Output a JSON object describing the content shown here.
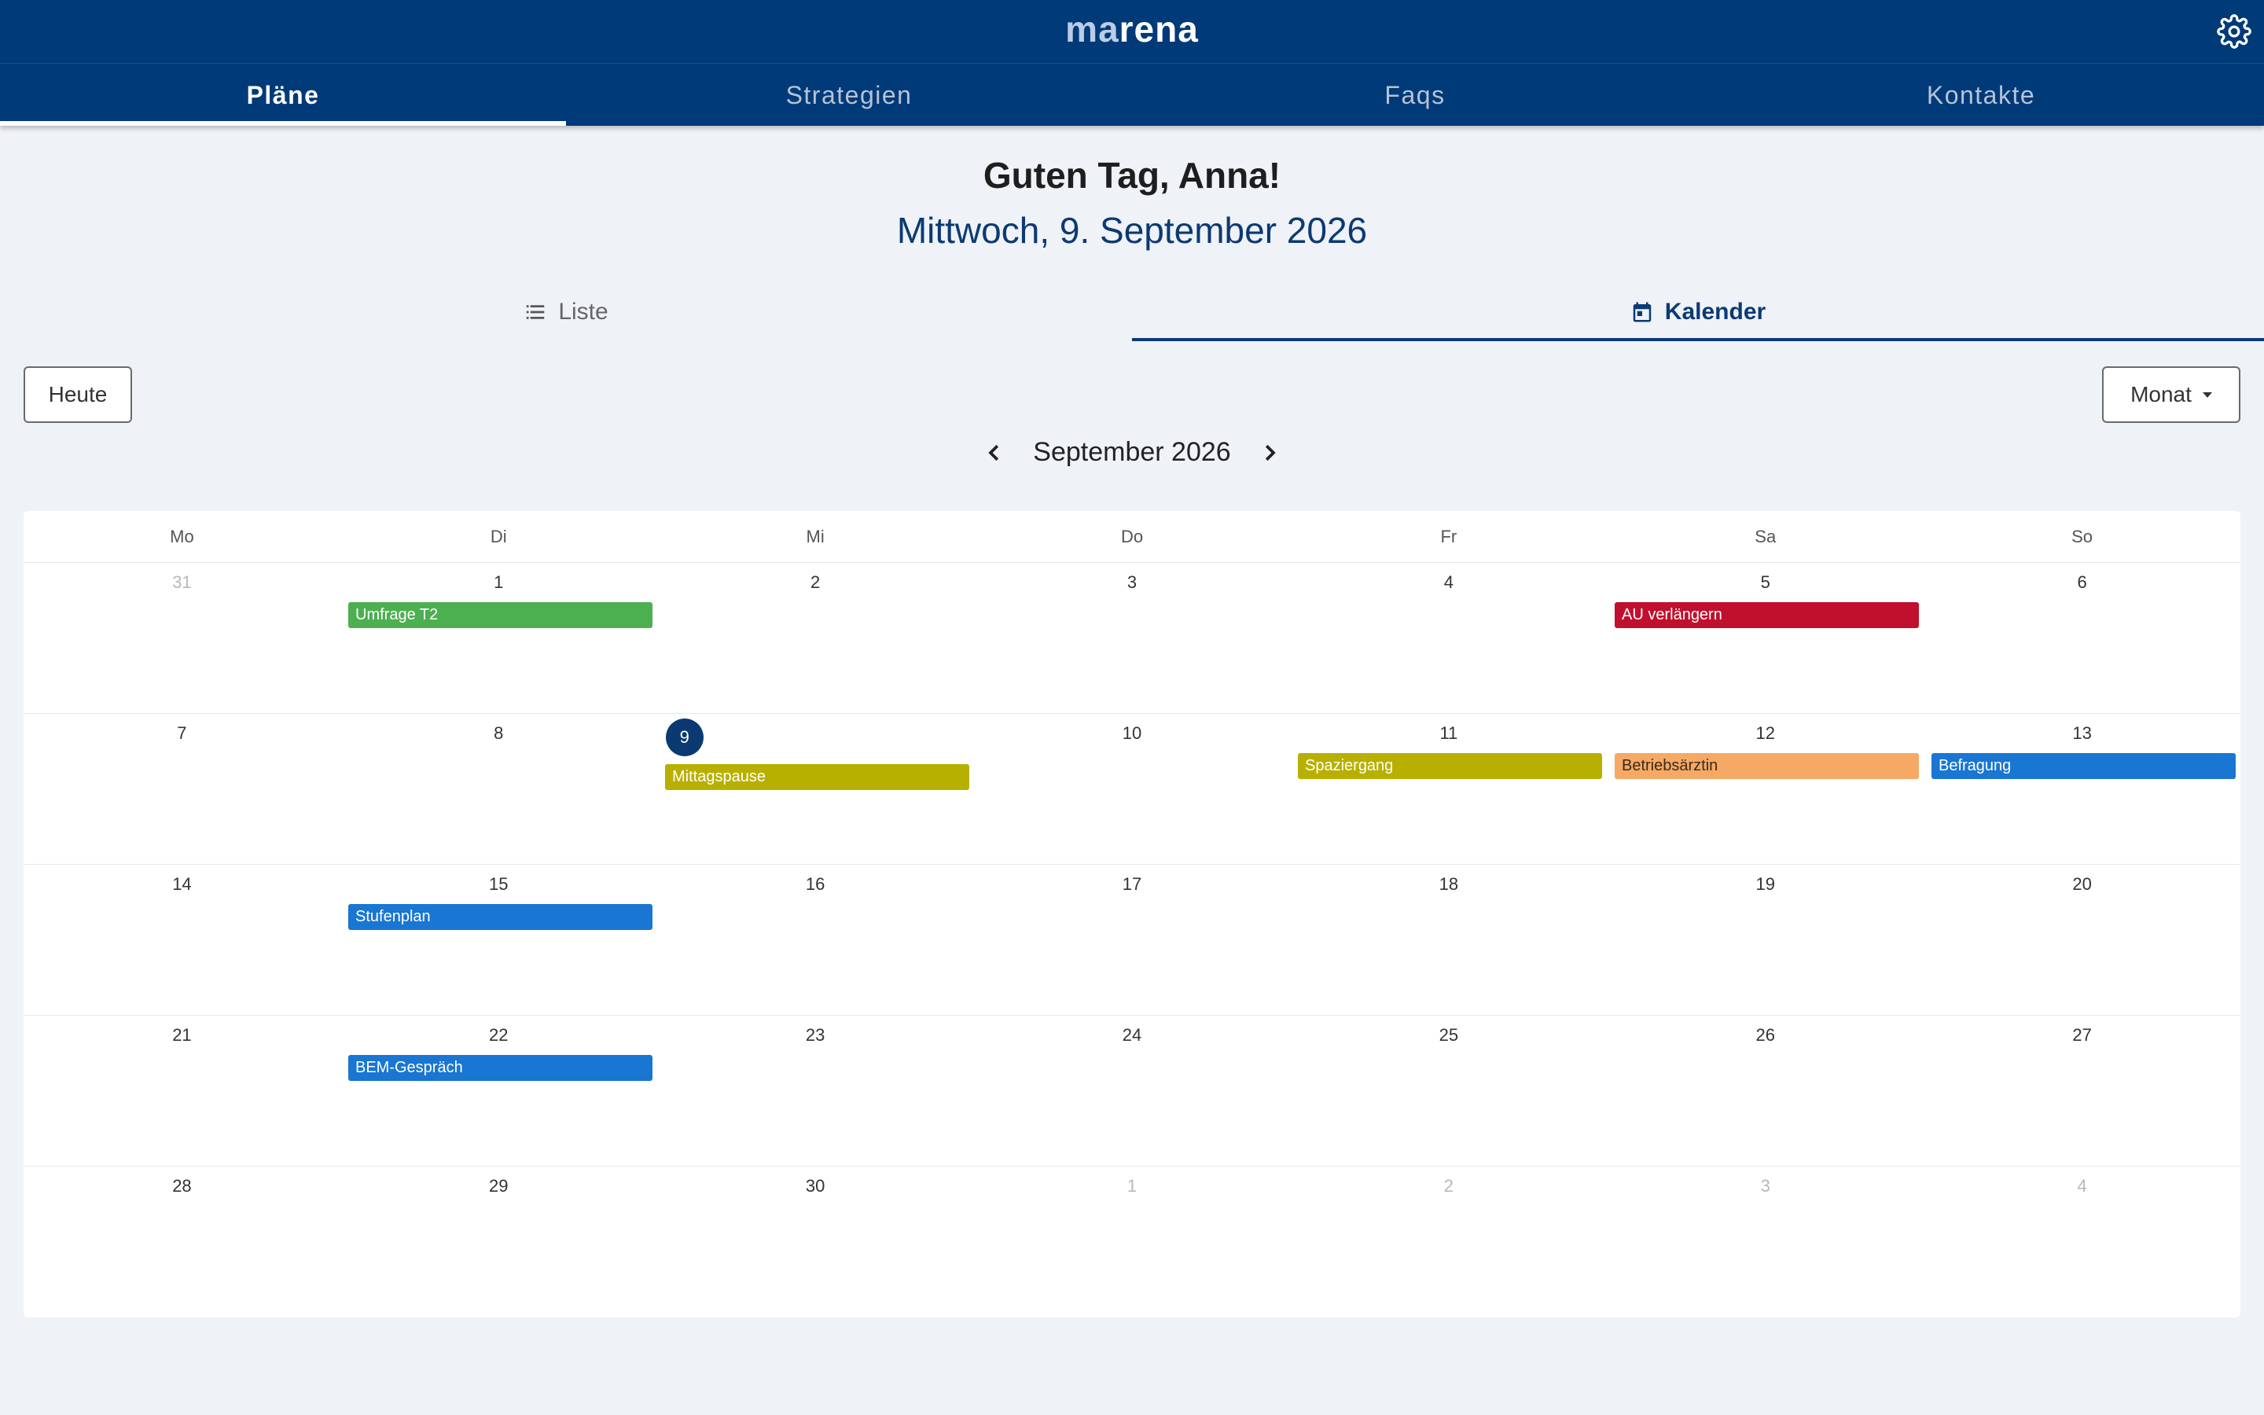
{
  "app": {
    "logo_prefix": "ma",
    "logo_suffix": "rena"
  },
  "nav": {
    "tabs": [
      "Pläne",
      "Strategien",
      "Faqs",
      "Kontakte"
    ]
  },
  "greeting": "Guten Tag, Anna!",
  "date": "Mittwoch, 9. September 2026",
  "view_tabs": {
    "list": "Liste",
    "calendar": "Kalender"
  },
  "controls": {
    "today": "Heute",
    "view_select": "Monat",
    "month_label": "September 2026"
  },
  "calendar": {
    "weekdays": [
      "Mo",
      "Di",
      "Mi",
      "Do",
      "Fr",
      "Sa",
      "So"
    ],
    "today": "9",
    "weeks": [
      [
        "31",
        "1",
        "2",
        "3",
        "4",
        "5",
        "6"
      ],
      [
        "7",
        "8",
        "9",
        "10",
        "11",
        "12",
        "13"
      ],
      [
        "14",
        "15",
        "16",
        "17",
        "18",
        "19",
        "20"
      ],
      [
        "21",
        "22",
        "23",
        "24",
        "25",
        "26",
        "27"
      ],
      [
        "28",
        "29",
        "30",
        "1",
        "2",
        "3",
        "4"
      ]
    ],
    "events": [
      {
        "label": "Umfrage T2",
        "week": 0,
        "day": 1,
        "color": "#4caf50"
      },
      {
        "label": "AU verlängern",
        "week": 0,
        "day": 5,
        "color": "#c0102d"
      },
      {
        "label": "Mittagspause",
        "week": 1,
        "day": 2,
        "color": "#b8b000"
      },
      {
        "label": "Spaziergang",
        "week": 1,
        "day": 4,
        "color": "#b8b000"
      },
      {
        "label": "Betriebsärztin",
        "week": 1,
        "day": 5,
        "color": "#f5a964",
        "text_color": "#3a2a1a"
      },
      {
        "label": "Befragung",
        "week": 1,
        "day": 6,
        "color": "#1976d2"
      },
      {
        "label": "Stufenplan",
        "week": 2,
        "day": 1,
        "color": "#1976d2"
      },
      {
        "label": "BEM-Gespräch",
        "week": 3,
        "day": 1,
        "color": "#1976d2"
      }
    ]
  },
  "colors": {
    "primary": "#003a78",
    "accent": "#0b3a72",
    "background": "#eff2f7"
  }
}
